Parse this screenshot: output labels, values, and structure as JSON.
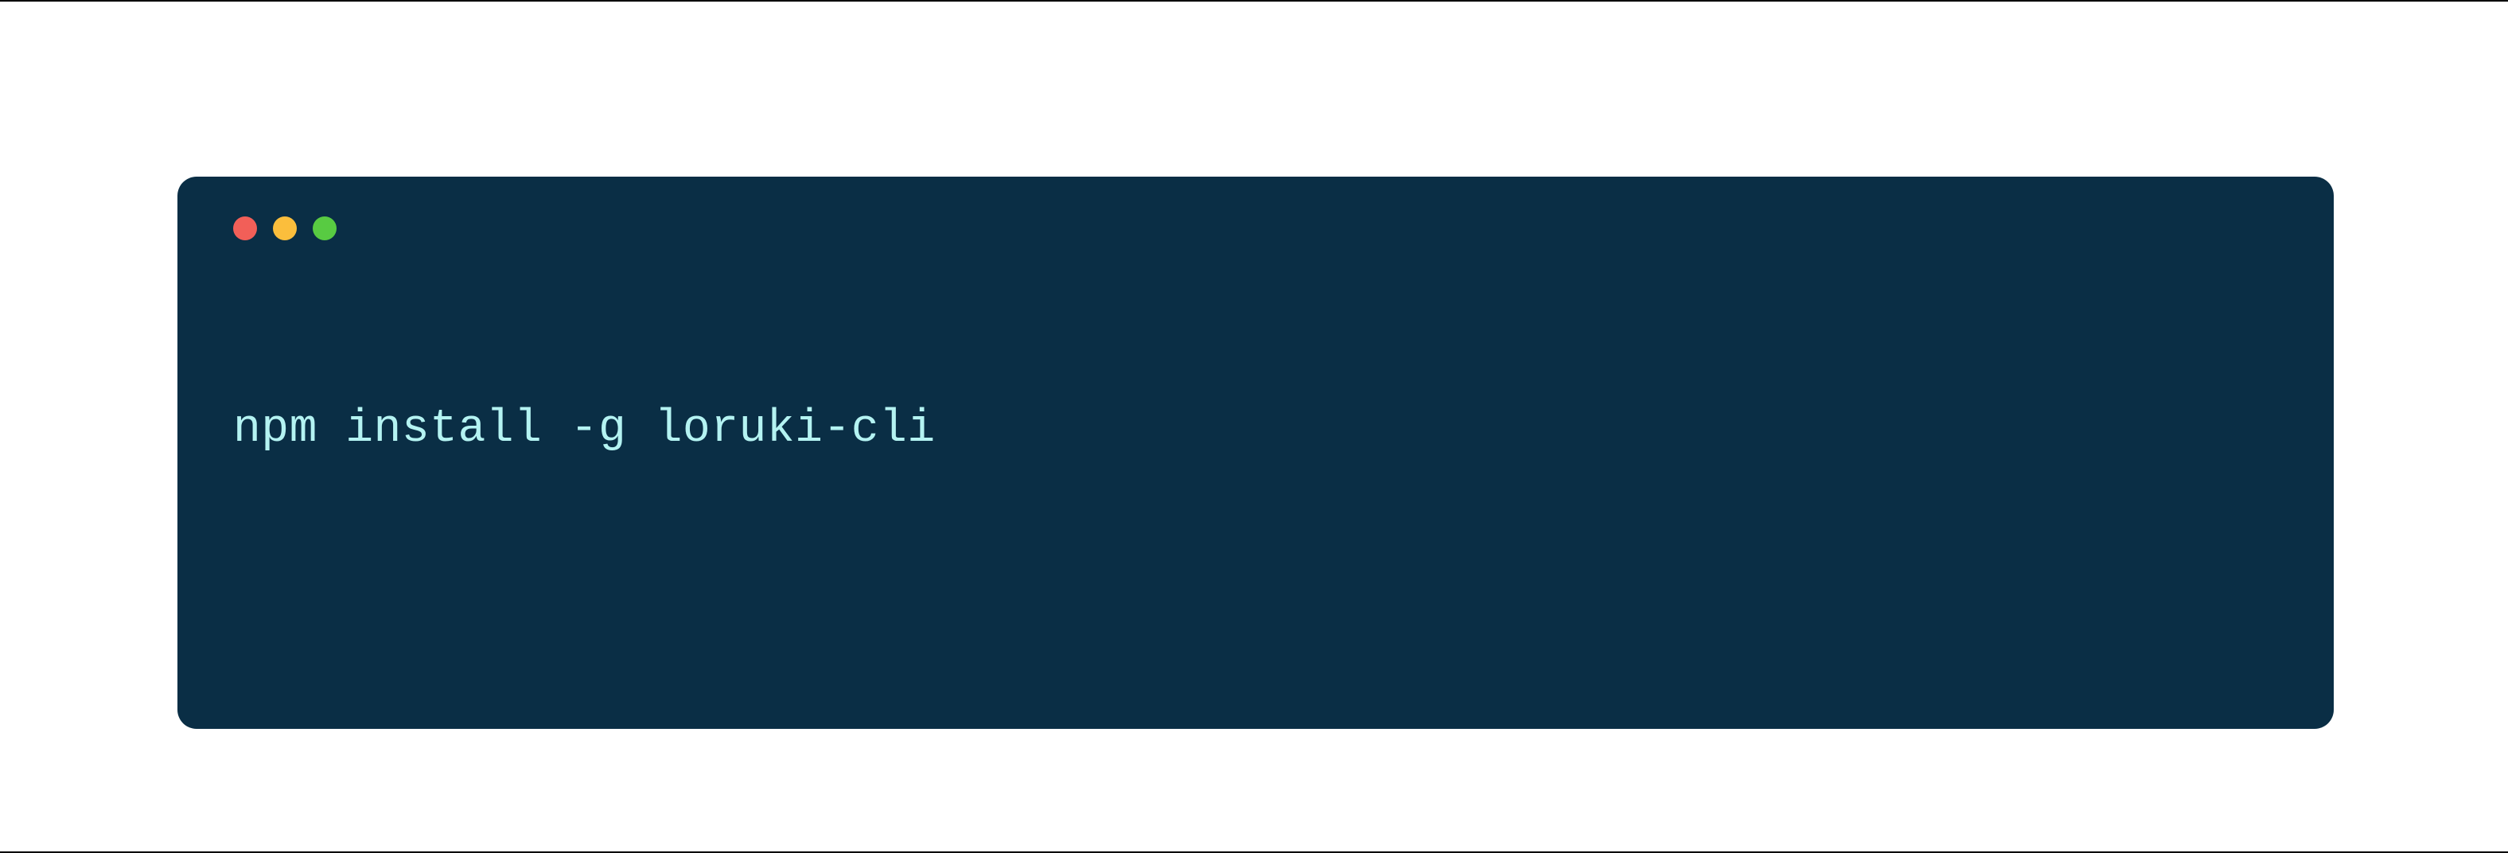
{
  "terminal": {
    "command": "npm install -g loruki-cli",
    "window_controls": {
      "close": "close",
      "minimize": "minimize",
      "maximize": "maximize"
    },
    "colors": {
      "background": "#0a2e45",
      "text": "#b4f3f2",
      "close_button": "#f25f58",
      "minimize_button": "#fbbe3c",
      "maximize_button": "#58cb42"
    }
  }
}
